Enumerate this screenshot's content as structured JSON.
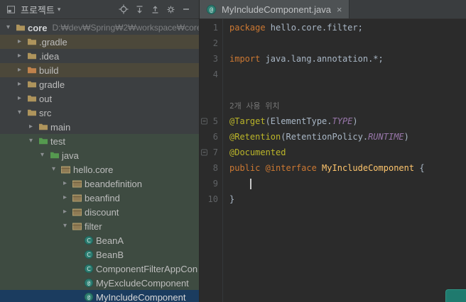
{
  "theme": {
    "panel_bg": "#3c3f41",
    "editor_bg": "#2b2b2b",
    "selection_bg": "#1b3c5f",
    "test_scope_bg": "#3e4b41",
    "excluded_bg": "#4c483a",
    "keyword_color": "#cc7832",
    "annotation_color": "#bbb529",
    "constant_color": "#9876aa",
    "class_decl_color": "#ffc66d"
  },
  "project_panel": {
    "header": {
      "title": "프로젝트",
      "icons": [
        "tool-window-icon",
        "chevron-down-icon",
        "locate-icon",
        "expand-all-icon",
        "collapse-all-icon",
        "settings-gear-icon",
        "hide-icon"
      ]
    },
    "tree": [
      {
        "label": "core",
        "suffix": "D:₩dev₩Spring₩2₩workspace₩core",
        "level": 0,
        "chevron": "down",
        "icon": "folder",
        "bold": true,
        "bg": "none",
        "selected": false
      },
      {
        "label": ".gradle",
        "level": 1,
        "chevron": "right",
        "icon": "folder",
        "bg": "excluded",
        "selected": false
      },
      {
        "label": ".idea",
        "level": 1,
        "chevron": "right",
        "icon": "folder",
        "bg": "none",
        "selected": false
      },
      {
        "label": "build",
        "level": 1,
        "chevron": "right",
        "icon": "folder-excluded",
        "bg": "excluded",
        "selected": false
      },
      {
        "label": "gradle",
        "level": 1,
        "chevron": "right",
        "icon": "folder",
        "bg": "none",
        "selected": false
      },
      {
        "label": "out",
        "level": 1,
        "chevron": "right",
        "icon": "folder",
        "bg": "none",
        "selected": false
      },
      {
        "label": "src",
        "level": 1,
        "chevron": "down",
        "icon": "folder",
        "bg": "none",
        "selected": false
      },
      {
        "label": "main",
        "level": 2,
        "chevron": "right",
        "icon": "folder",
        "bg": "none",
        "selected": false
      },
      {
        "label": "test",
        "level": 2,
        "chevron": "down",
        "icon": "folder-test",
        "bg": "test",
        "selected": false
      },
      {
        "label": "java",
        "level": 3,
        "chevron": "down",
        "icon": "folder-test",
        "bg": "test",
        "selected": false
      },
      {
        "label": "hello.core",
        "level": 4,
        "chevron": "down",
        "icon": "package",
        "bg": "test",
        "selected": false
      },
      {
        "label": "beandefinition",
        "level": 5,
        "chevron": "right",
        "icon": "package",
        "bg": "test",
        "selected": false
      },
      {
        "label": "beanfind",
        "level": 5,
        "chevron": "right",
        "icon": "package",
        "bg": "test",
        "selected": false
      },
      {
        "label": "discount",
        "level": 5,
        "chevron": "right",
        "icon": "package",
        "bg": "test",
        "selected": false
      },
      {
        "label": "filter",
        "level": 5,
        "chevron": "down",
        "icon": "package",
        "bg": "test",
        "selected": false
      },
      {
        "label": "BeanA",
        "level": 6,
        "chevron": "none",
        "icon": "class",
        "bg": "test",
        "selected": false
      },
      {
        "label": "BeanB",
        "level": 6,
        "chevron": "none",
        "icon": "class",
        "bg": "test",
        "selected": false
      },
      {
        "label": "ComponentFilterAppCon",
        "level": 6,
        "chevron": "none",
        "icon": "class",
        "bg": "test",
        "selected": false
      },
      {
        "label": "MyExcludeComponent",
        "level": 6,
        "chevron": "none",
        "icon": "annotation",
        "bg": "test",
        "selected": false
      },
      {
        "label": "MyIncludeComponent",
        "level": 6,
        "chevron": "none",
        "icon": "annotation",
        "bg": "test",
        "selected": true
      }
    ]
  },
  "editor": {
    "tab": {
      "label": "MyIncludeComponent.java",
      "icon": "annotation-file-icon",
      "close_glyph": "×"
    },
    "rows": [
      {
        "num": "1",
        "tokens": [
          {
            "c": "kw",
            "t": "package "
          },
          {
            "c": "pl",
            "t": "hello.core.filter;"
          }
        ]
      },
      {
        "num": "2",
        "tokens": []
      },
      {
        "num": "3",
        "tokens": [
          {
            "c": "kw",
            "t": "import "
          },
          {
            "c": "pl",
            "t": "java.lang.annotation.*;"
          }
        ]
      },
      {
        "num": "4",
        "tokens": []
      },
      {
        "type": "spacer"
      },
      {
        "type": "hint",
        "hint": "2개 사용 위치"
      },
      {
        "num": "5",
        "fold": true,
        "tokens": [
          {
            "c": "ann",
            "t": "@Target"
          },
          {
            "c": "pl",
            "t": "(ElementType."
          },
          {
            "c": "const",
            "t": "TYPE"
          },
          {
            "c": "pl",
            "t": ")"
          }
        ]
      },
      {
        "num": "6",
        "tokens": [
          {
            "c": "ann",
            "t": "@Retention"
          },
          {
            "c": "pl",
            "t": "(RetentionPolicy."
          },
          {
            "c": "const",
            "t": "RUNTIME"
          },
          {
            "c": "pl",
            "t": ")"
          }
        ]
      },
      {
        "num": "7",
        "fold": true,
        "tokens": [
          {
            "c": "ann",
            "t": "@Documented"
          }
        ]
      },
      {
        "num": "8",
        "tokens": [
          {
            "c": "kw",
            "t": "public @interface "
          },
          {
            "c": "decl",
            "t": "MyIncludeComponent"
          },
          {
            "c": "pl",
            "t": " {"
          }
        ]
      },
      {
        "num": "9",
        "caret": true,
        "tokens": []
      },
      {
        "num": "10",
        "tokens": [
          {
            "c": "pl",
            "t": "}"
          }
        ]
      }
    ]
  }
}
